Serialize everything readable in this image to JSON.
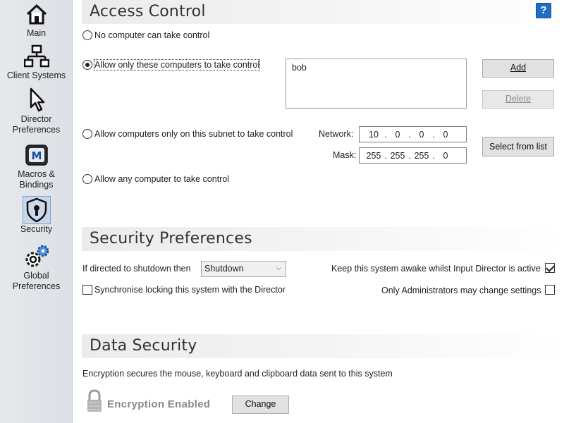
{
  "sidebar": {
    "items": [
      {
        "label": "Main",
        "icon": "home-icon"
      },
      {
        "label": "Client Systems",
        "icon": "network-icon"
      },
      {
        "label_line1": "Director",
        "label_line2": "Preferences",
        "icon": "cursor-icon"
      },
      {
        "label_line1": "Macros &",
        "label_line2": "Bindings",
        "icon": "macro-icon"
      },
      {
        "label": "Security",
        "icon": "shield-icon",
        "active": true
      },
      {
        "label_line1": "Global",
        "label_line2": "Preferences",
        "icon": "gears-icon"
      }
    ]
  },
  "access_control": {
    "title": "Access Control",
    "help": "?",
    "options": {
      "none": "No computer can take control",
      "only_these": "Allow only these computers to take control",
      "subnet": "Allow computers only on this subnet to take control",
      "any": "Allow any computer to take control"
    },
    "selected": "only_these",
    "allowed_list": [
      "bob"
    ],
    "add_button": "Add",
    "delete_button": "Delete",
    "network_label": "Network:",
    "network_octets": [
      "10",
      "0",
      "0",
      "0"
    ],
    "mask_label": "Mask:",
    "mask_octets": [
      "255",
      "255",
      "255",
      "0"
    ],
    "select_from_list_button": "Select from list"
  },
  "security_prefs": {
    "title": "Security Preferences",
    "shutdown_label": "If directed to shutdown then",
    "shutdown_value": "Shutdown",
    "sync_lock_label": "Synchronise locking this system with the Director",
    "sync_lock_checked": false,
    "keep_awake_label": "Keep this system awake whilst Input Director is active",
    "keep_awake_checked": true,
    "admin_only_label": "Only Administrators may change settings",
    "admin_only_checked": false
  },
  "data_security": {
    "title": "Data Security",
    "description": "Encryption secures the mouse, keyboard and clipboard data sent to this system",
    "status": "Encryption Enabled",
    "change_button": "Change"
  },
  "colors": {
    "help_bg": "#1f6fc4",
    "sidebar_bg": "#e0e3e8"
  }
}
